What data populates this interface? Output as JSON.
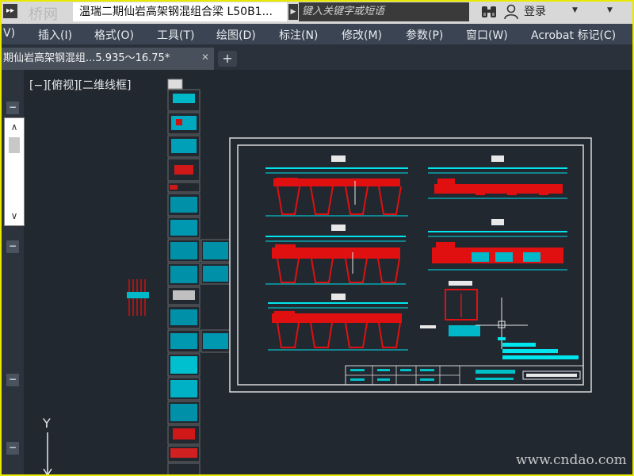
{
  "titlebar": {
    "quick_access": "▸▸",
    "logo": "桥网",
    "document_title": "温瑞二期仙岩高架钢混组合梁 L50B1...",
    "arrow": "▶",
    "search_placeholder": "键入关键字或短语",
    "login_label": "登录",
    "login_caret": "▼",
    "help_caret": "▼"
  },
  "menu": {
    "items": [
      "V)",
      "插入(I)",
      "格式(O)",
      "工具(T)",
      "绘图(D)",
      "标注(N)",
      "修改(M)",
      "参数(P)",
      "窗口(W)",
      "Acrobat 标记(C)"
    ]
  },
  "tabs": {
    "active_tab": "期仙岩高架钢混组...5.935～16.75*",
    "close_glyph": "✕",
    "new_tab_glyph": "+"
  },
  "left_panel": {
    "collapse_glyph": "−",
    "scroll_up": "∧",
    "scroll_down": "∨"
  },
  "canvas": {
    "viewport_label": "[−][俯视][二维线框]",
    "ucs_axis_label": "Y",
    "watermark": "www.cndao.com"
  },
  "colors": {
    "canvas_bg": "#212830",
    "drawing_cyan": "#00e5ee",
    "drawing_red": "#e01010",
    "drawing_white": "#e8e8e8",
    "window_border": "#e8e800"
  }
}
